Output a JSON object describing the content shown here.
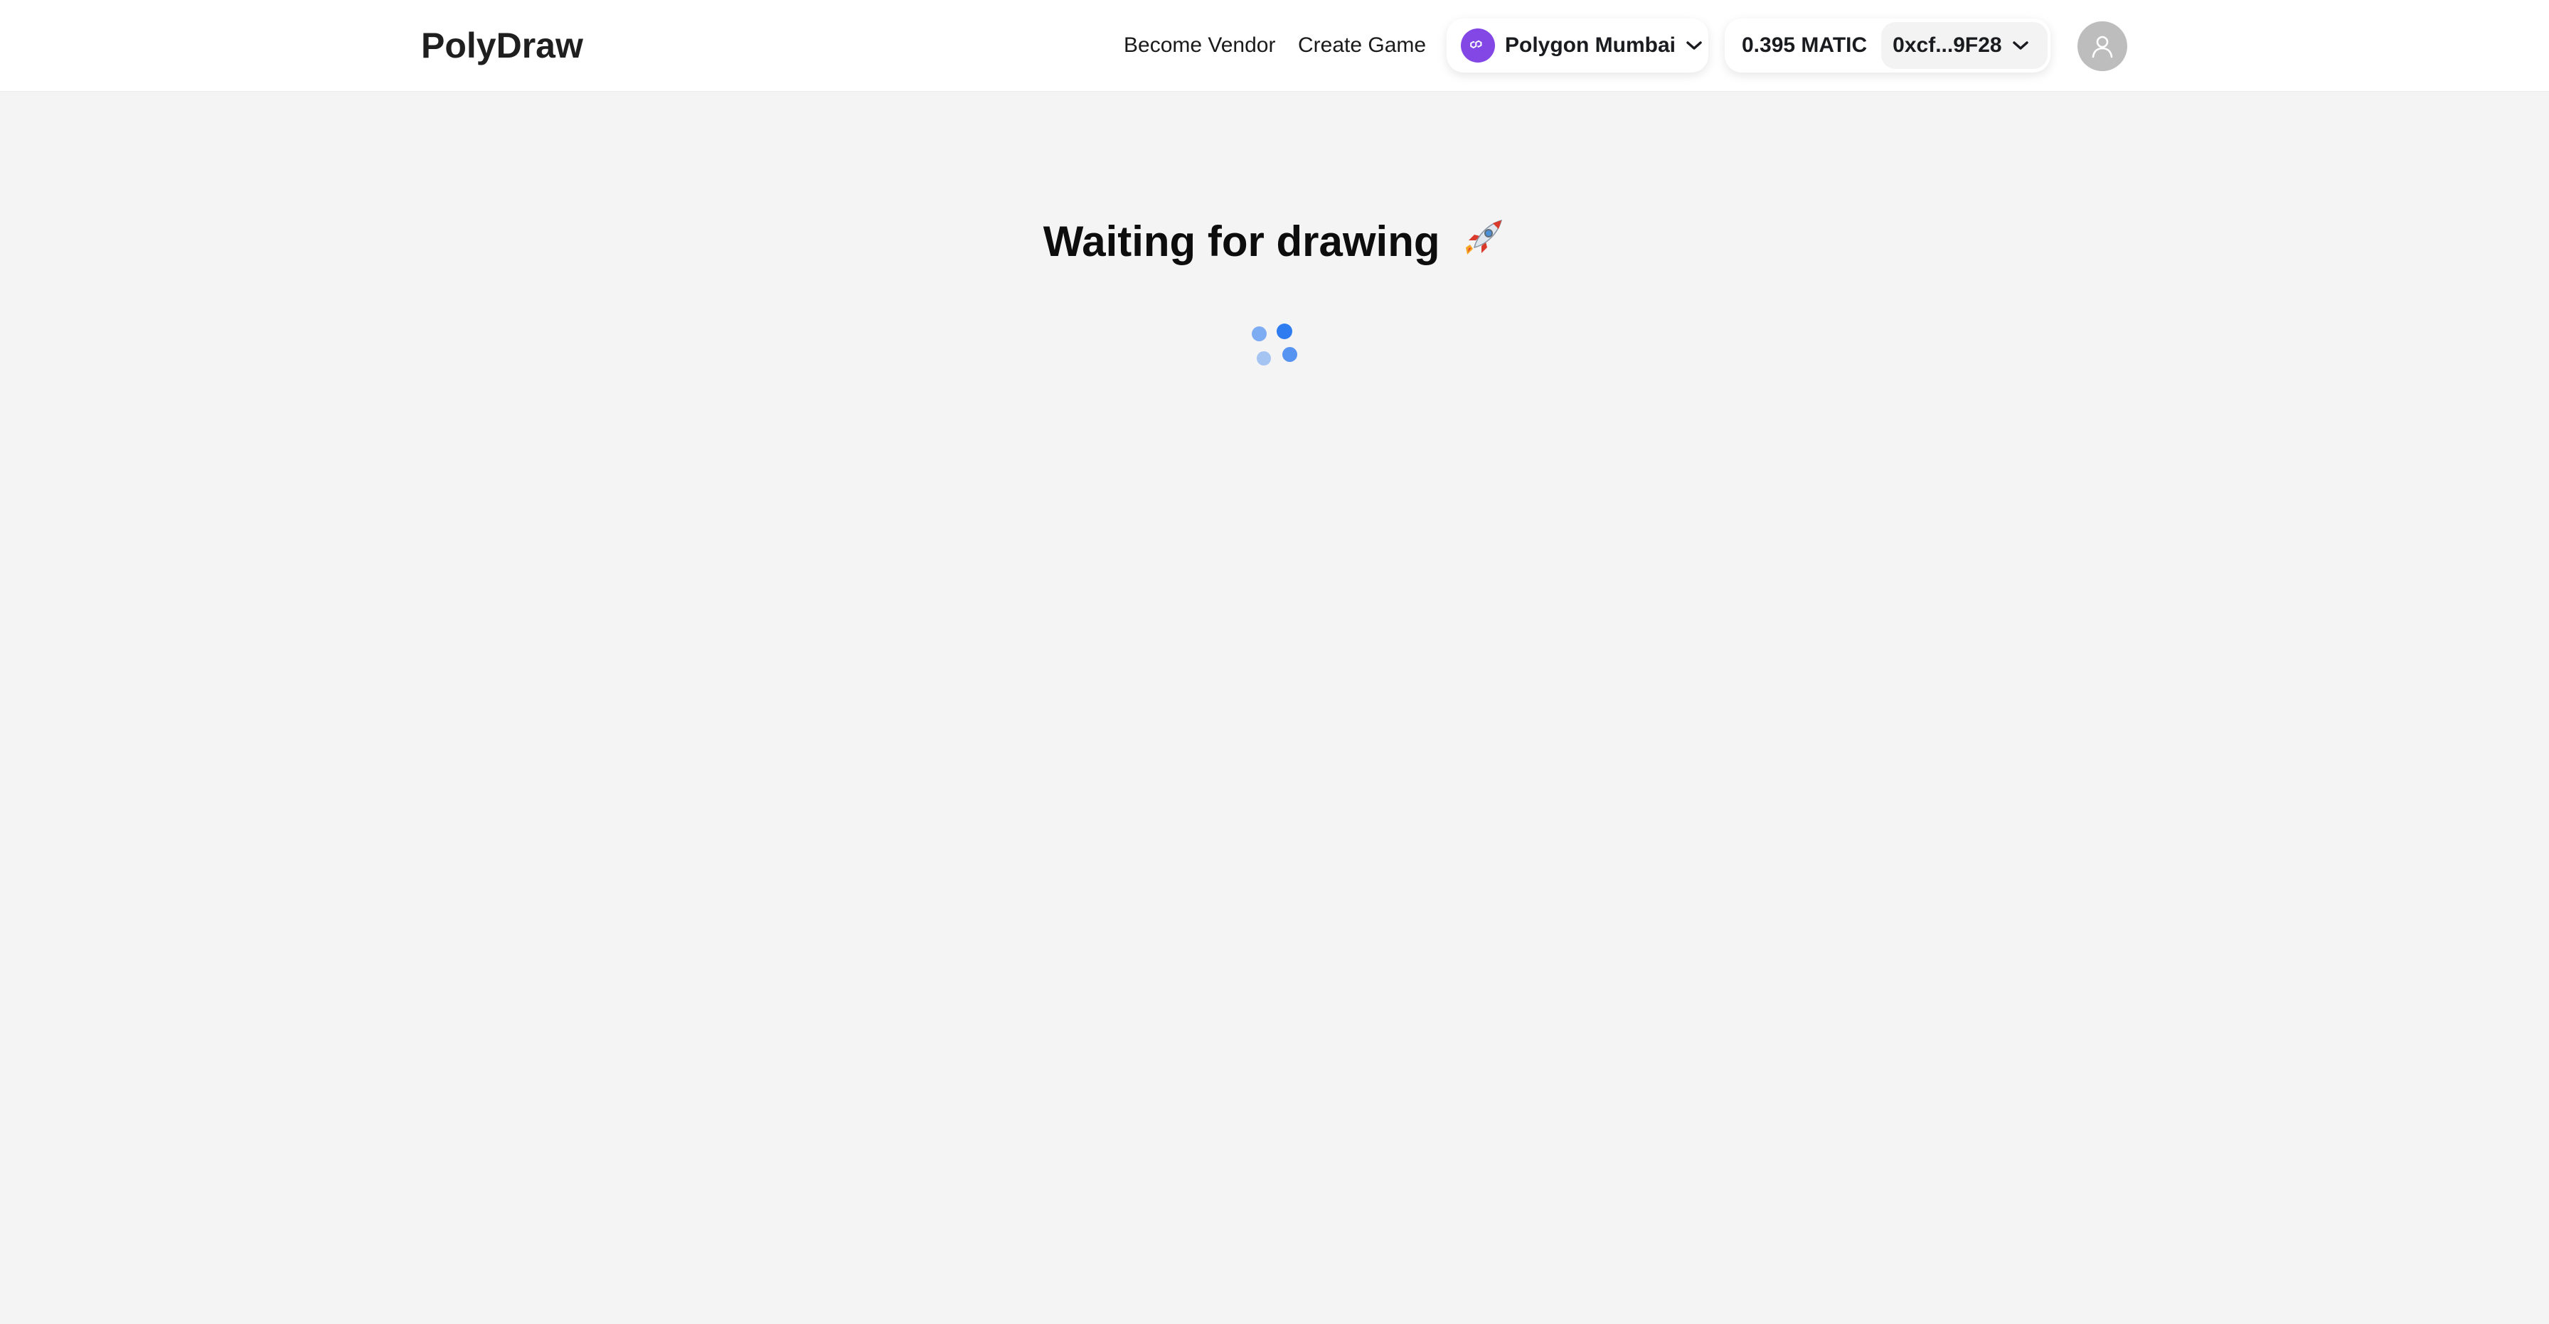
{
  "header": {
    "logo": "PolyDraw",
    "nav": {
      "become_vendor": "Become Vendor",
      "create_game": "Create Game"
    },
    "network": {
      "name": "Polygon Mumbai",
      "icon": "polygon-icon",
      "accent": "#8247e5"
    },
    "account": {
      "balance": "0.395 MATIC",
      "address": "0xcf...9F28"
    },
    "avatar": {
      "icon": "user-icon"
    }
  },
  "main": {
    "heading": "Waiting for drawing",
    "heading_icon": "rocket-icon",
    "loader": {
      "icon": "loading-spinner",
      "color": "#2f7cf0"
    }
  },
  "colors": {
    "background": "#f4f4f4",
    "header_bg": "#ffffff"
  }
}
